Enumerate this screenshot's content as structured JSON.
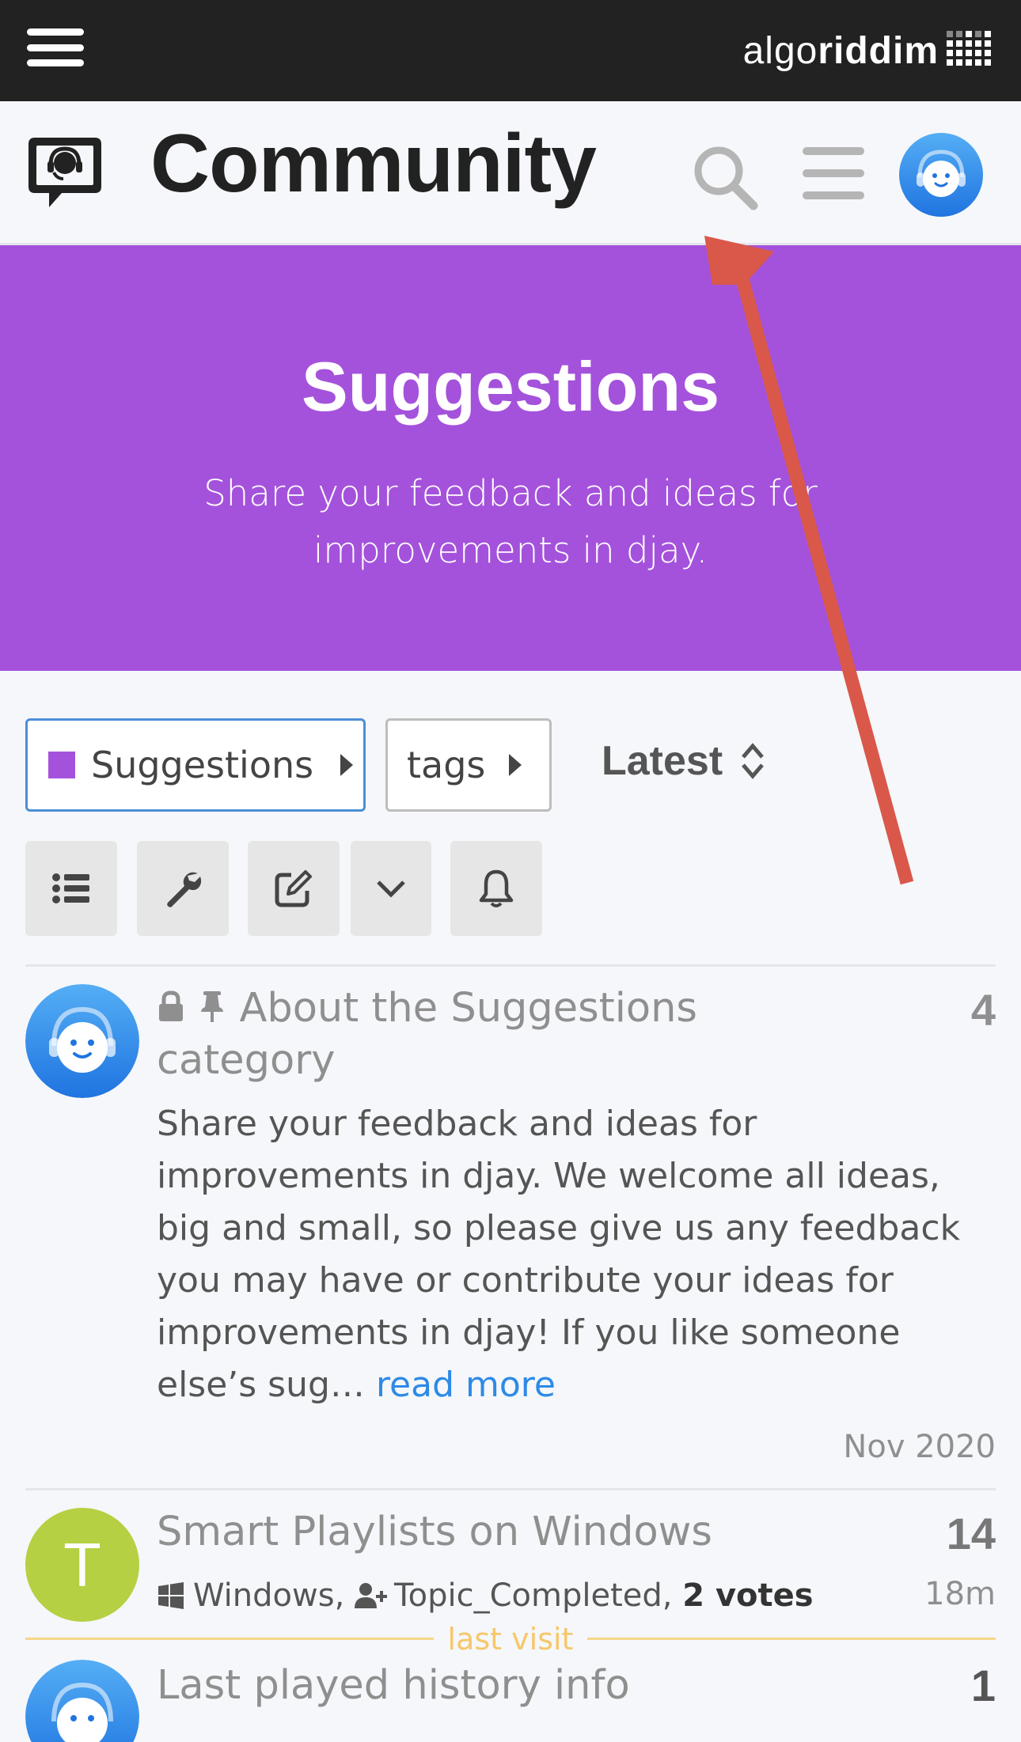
{
  "topbar": {
    "brand_light": "algo",
    "brand_bold": "riddim"
  },
  "header": {
    "title": "Community"
  },
  "banner": {
    "title": "Suggestions",
    "description": "Share your feedback and ideas for improvements in djay."
  },
  "filters": {
    "category": "Suggestions",
    "tags": "tags",
    "sort": "Latest"
  },
  "toolbar": {
    "icons": [
      "list-icon",
      "wrench-icon",
      "edit-icon",
      "chevron-down-icon",
      "bell-icon"
    ]
  },
  "topics": [
    {
      "title": "About the Suggestions category",
      "count": "4",
      "excerpt": "Share your feedback and ideas for improvements in djay. We welcome all ideas, big and small, so please give us any feedback you may have or contribute your ideas for improvements in djay! If you like someone else’s sug…",
      "read_more": "read more",
      "date": "Nov 2020"
    },
    {
      "title": "Smart Playlists on Windows",
      "avatar_letter": "T",
      "count": "14",
      "time": "18m",
      "tag1": "Windows",
      "tag2": "Topic_Completed",
      "votes": "2 votes"
    },
    {
      "title": "Last played history info",
      "count": "1"
    }
  ],
  "last_visit": "last visit",
  "colors": {
    "topbar": "#222222",
    "banner": "#a452db",
    "avatar_blue": "#2e8ae6",
    "avatar_green": "#b5d042",
    "link": "#2e8ae6",
    "annotation_arrow": "#d9584a"
  }
}
